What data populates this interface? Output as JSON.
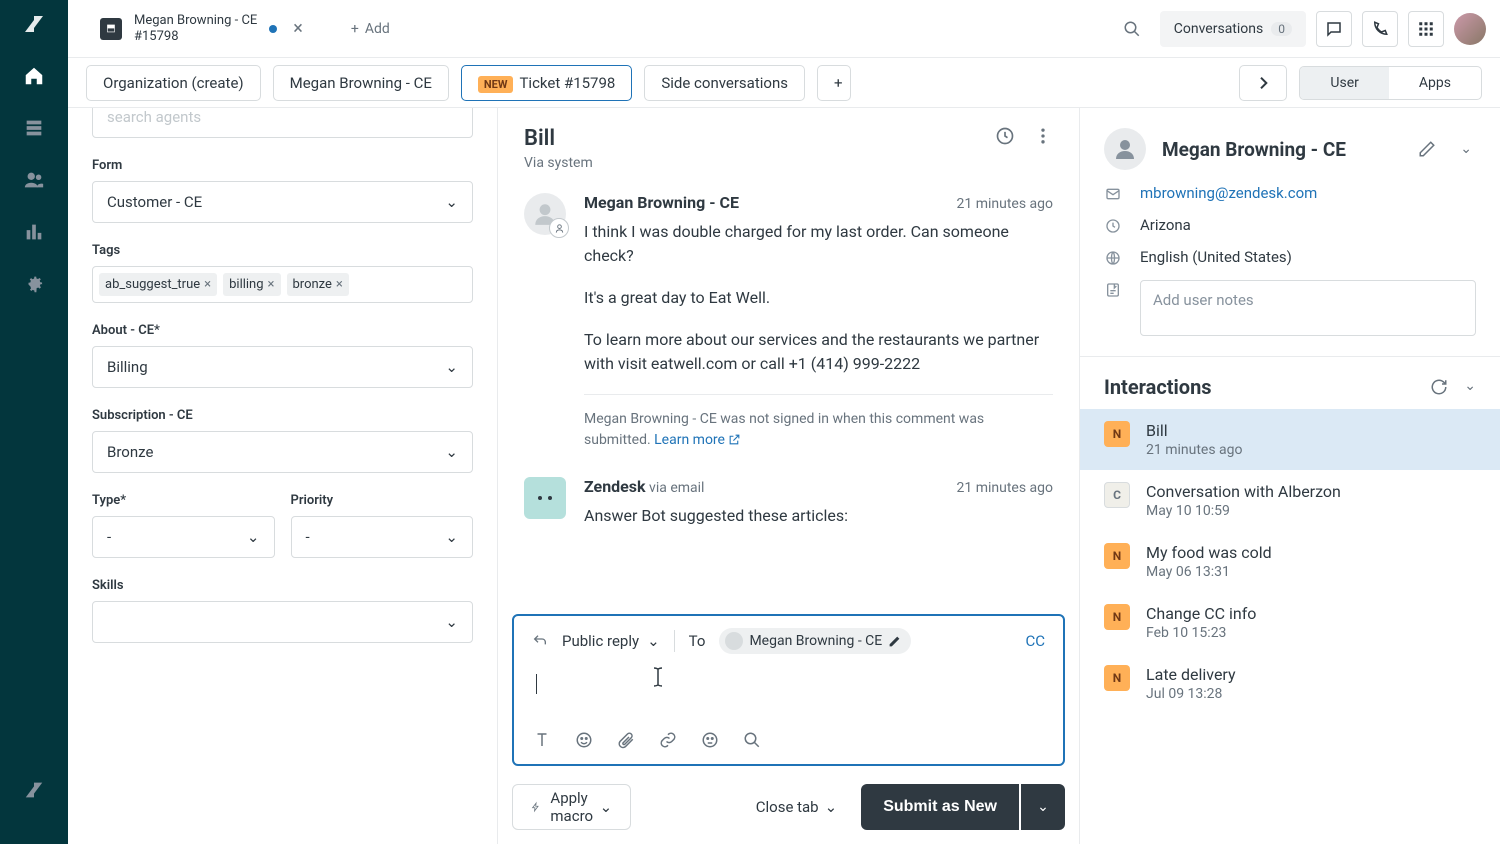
{
  "tab": {
    "title_line1": "Megan Browning - CE",
    "title_line2": "#15798",
    "add_label": "Add"
  },
  "topbar": {
    "conversations_label": "Conversations",
    "conversations_count": "0"
  },
  "subtabs": {
    "org": "Organization (create)",
    "user": "Megan Browning - CE",
    "new_badge": "NEW",
    "ticket": "Ticket #15798",
    "side": "Side conversations",
    "toggle_user": "User",
    "toggle_apps": "Apps"
  },
  "left": {
    "search_placeholder": "search agents",
    "form_label": "Form",
    "form_value": "Customer - CE",
    "tags_label": "Tags",
    "tags": [
      "ab_suggest_true",
      "billing",
      "bronze"
    ],
    "about_label": "About - CE*",
    "about_value": "Billing",
    "subscription_label": "Subscription - CE",
    "subscription_value": "Bronze",
    "type_label": "Type*",
    "type_value": "-",
    "priority_label": "Priority",
    "priority_value": "-",
    "skills_label": "Skills",
    "skills_value": ""
  },
  "conversation": {
    "title": "Bill",
    "via": "Via system",
    "msg1": {
      "name": "Megan Browning - CE",
      "time": "21 minutes ago",
      "p1": "I think I was double charged for my last order. Can someone check?",
      "p2": "It's a great day to Eat Well.",
      "p3": "To learn more about our services and the restaurants we partner with visit eatwell.com or call +1 (414) 999-2222",
      "note": "Megan Browning - CE was not signed in when this comment was submitted. ",
      "learn_more": "Learn more"
    },
    "msg2": {
      "name": "Zendesk",
      "via": " via email",
      "time": "21 minutes ago",
      "p1": "Answer Bot suggested these articles:"
    }
  },
  "composer": {
    "reply_type": "Public reply",
    "to_label": "To",
    "to_chip": "Megan Browning - CE",
    "cc": "CC"
  },
  "footer": {
    "macro": "Apply macro",
    "close_tab": "Close tab",
    "submit": "Submit as New"
  },
  "right_panel": {
    "name": "Megan Browning - CE",
    "email": "mbrowning@zendesk.com",
    "location": "Arizona",
    "language": "English (United States)",
    "notes_placeholder": "Add user notes",
    "interactions_label": "Interactions",
    "interactions": [
      {
        "badge": "N",
        "title": "Bill",
        "time": "21 minutes ago",
        "selected": true
      },
      {
        "badge": "C",
        "title": "Conversation with Alberzon",
        "time": "May 10 10:59"
      },
      {
        "badge": "N",
        "title": "My food was cold",
        "time": "May 06 13:31"
      },
      {
        "badge": "N",
        "title": "Change CC info",
        "time": "Feb 10 15:23"
      },
      {
        "badge": "N",
        "title": "Late delivery",
        "time": "Jul 09 13:28"
      }
    ]
  }
}
